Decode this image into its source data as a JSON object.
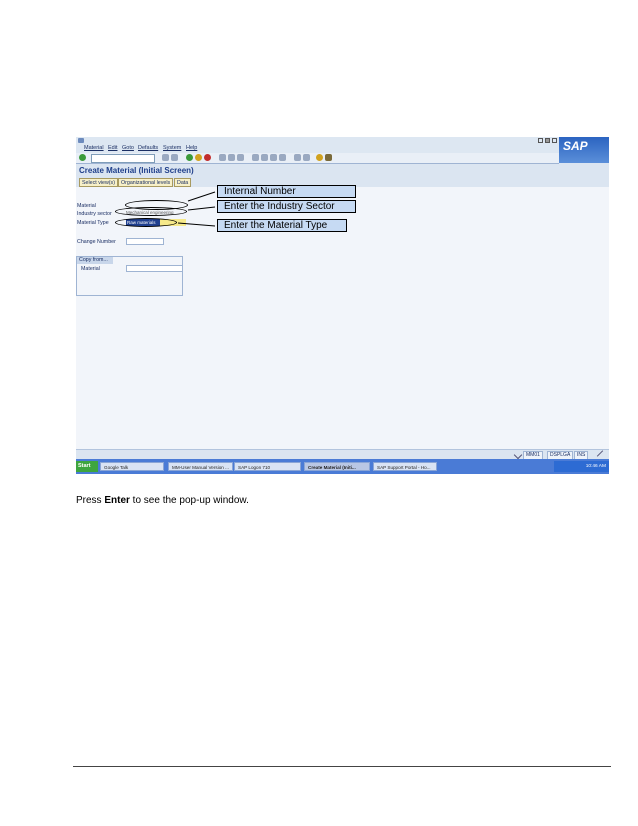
{
  "menu": [
    "Material",
    "Edit",
    "Goto",
    "Defaults",
    "System",
    "Help"
  ],
  "brand": "SAP",
  "screen_title": "Create Material (Initial Screen)",
  "app_buttons": [
    "Select view(s)",
    "Organizational levels",
    "Data"
  ],
  "form": {
    "material_label": "Material",
    "industry_label": "Industry sector",
    "industry_value": "Mechanical engineering",
    "type_label": "Material Type",
    "type_value": "Raw materials",
    "change_label": "Change Number"
  },
  "copy_from": {
    "title": "Copy from...",
    "material_label": "Material"
  },
  "status": [
    "MM01",
    "DSPLGA",
    "INS"
  ],
  "taskbar": {
    "start": "Start",
    "tasks": [
      "Google Talk",
      "MM-User Manual Version ...",
      "SAP Logon 710",
      "Create Material (Initi...",
      "SAP Support Portal - Ho..."
    ],
    "clock": "10:46 AM"
  },
  "callouts": [
    "Internal Number",
    "Enter the Industry Sector",
    "Enter the Material Type"
  ],
  "instruction": {
    "before": "Press ",
    "bold": "Enter",
    "after": " to see the pop-up window."
  }
}
